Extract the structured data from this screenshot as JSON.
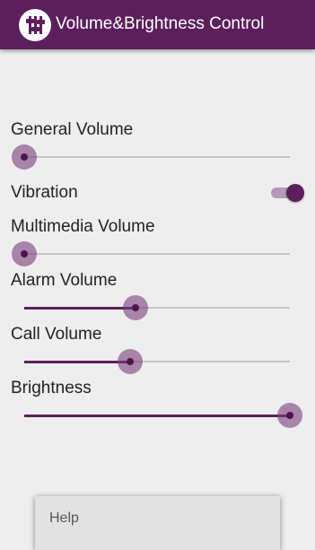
{
  "app": {
    "title": "Volume&Brightness Control",
    "icon": "sliders-icon"
  },
  "controls": {
    "general_volume": {
      "label": "General Volume",
      "level": 0
    },
    "vibration": {
      "label": "Vibration",
      "enabled": true
    },
    "multimedia_volume": {
      "label": "Multimedia Volume",
      "level": 0
    },
    "alarm_volume": {
      "label": "Alarm Volume",
      "level": 0.42
    },
    "call_volume": {
      "label": "Call Volume",
      "level": 0.4
    },
    "brightness": {
      "label": "Brightness",
      "level": 1.0
    }
  },
  "menu": {
    "items": [
      {
        "label": "Help"
      }
    ]
  },
  "colors": {
    "accent": "#5b1f5c",
    "background": "#eeeeee",
    "track": "#c4c4c4"
  }
}
